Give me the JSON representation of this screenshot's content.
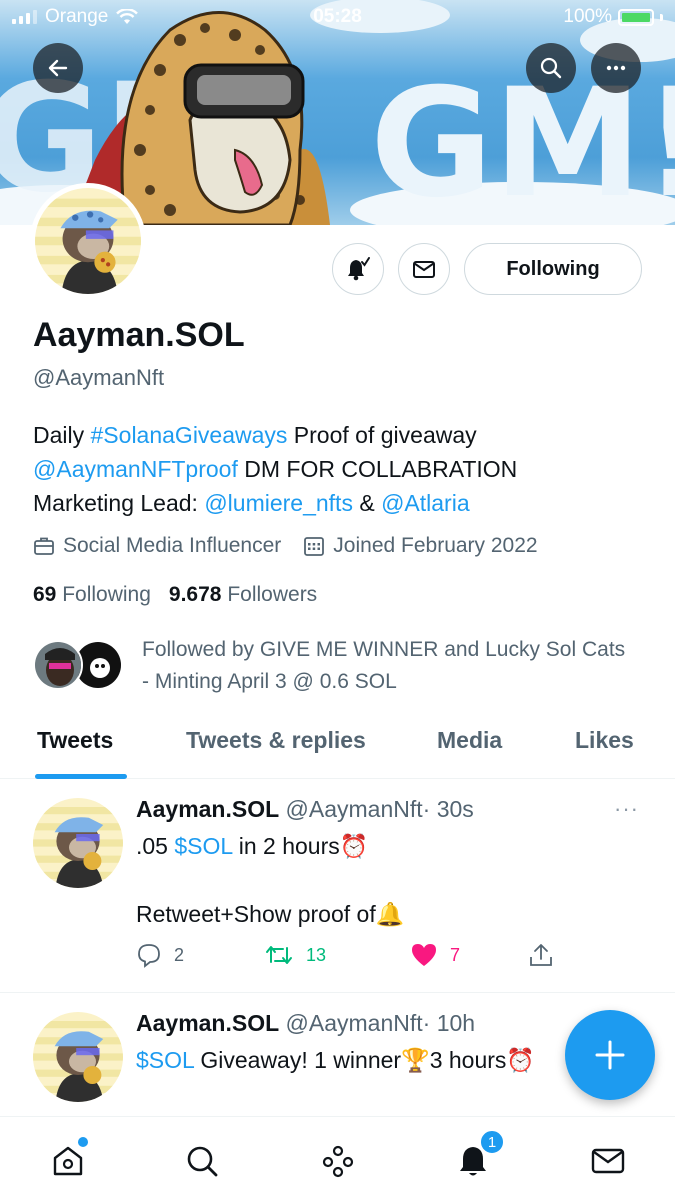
{
  "status_bar": {
    "carrier": "Orange",
    "time": "05:28",
    "battery": "100%"
  },
  "banner": {
    "text": "GM GM!"
  },
  "profile": {
    "name": "Aayman.SOL",
    "handle": "@AaymanNft",
    "bio": {
      "line1_pre": "Daily ",
      "line1_tag": "#SolanaGiveaways",
      "line1_post": " Proof of giveaway",
      "line2_mention": "@AaymanNFTproof",
      "line2_post": " DM FOR COLLABRATION",
      "line3_pre": "Marketing Lead: ",
      "line3_mention1": "@lumiere_nfts",
      "line3_amp": " & ",
      "line3_mention2": "@Atlaria"
    },
    "category": "Social Media Influencer",
    "joined": "Joined February 2022",
    "following_count": "69",
    "following_label": "Following",
    "followers_count": "9.678",
    "followers_label": "Followers",
    "followed_by": "Followed by GIVE ME WINNER and Lucky Sol Cats - Minting April 3 @ 0.6 SOL",
    "follow_button": "Following"
  },
  "tabs": [
    "Tweets",
    "Tweets & replies",
    "Media",
    "Likes"
  ],
  "tweets": [
    {
      "name": "Aayman.SOL",
      "handle": "@AaymanNft",
      "time": "· 30s",
      "line1_pre": ".05 ",
      "line1_tag": "$SOL",
      "line1_post": " in 2 hours⏰",
      "line2": "Retweet+Show proof of🔔",
      "replies": "2",
      "retweets": "13",
      "likes": "7",
      "colors": {
        "retweet": "#00ba7c",
        "like": "#f91880"
      }
    },
    {
      "name": "Aayman.SOL",
      "handle": "@AaymanNft",
      "time": "· 10h",
      "line1_tag": "$SOL",
      "line1_post": " Giveaway! 1 winner🏆3 hours⏰"
    }
  ],
  "icons": {
    "back": "back-arrow-icon",
    "search": "search-icon",
    "more": "more-icon",
    "notify": "bell-icon",
    "message": "mail-icon",
    "briefcase": "briefcase-icon",
    "calendar": "calendar-icon"
  },
  "nav": {
    "notifications_badge": "1"
  },
  "colors": {
    "accent": "#1d9bf0",
    "text": "#0f1419",
    "secondary": "#536471"
  }
}
